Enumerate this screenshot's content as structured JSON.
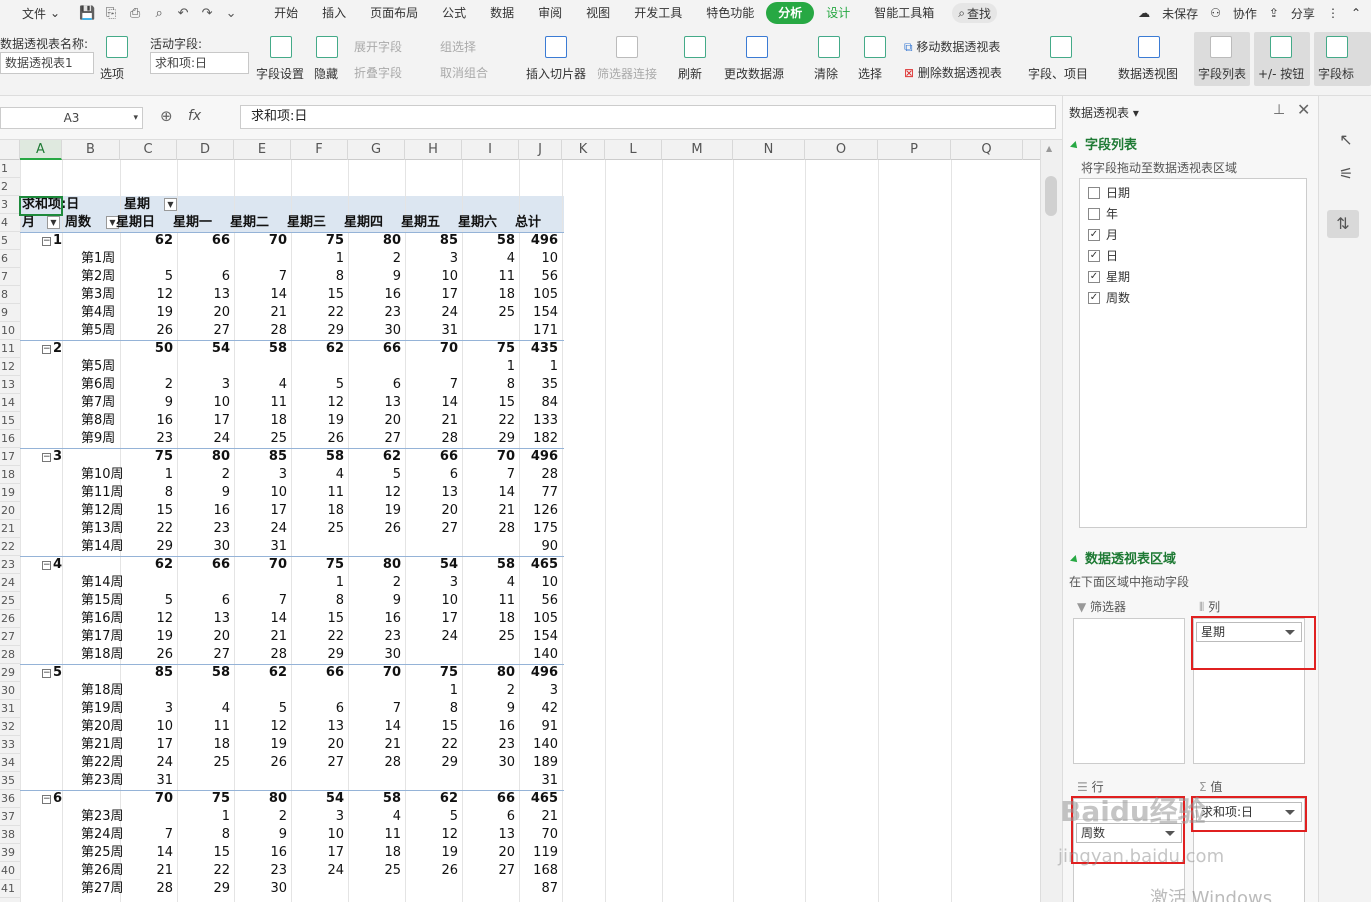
{
  "menu": {
    "file": "文件",
    "tabs": [
      "开始",
      "插入",
      "页面布局",
      "公式",
      "数据",
      "审阅",
      "视图",
      "开发工具",
      "特色功能",
      "分析",
      "设计",
      "智能工具箱"
    ],
    "active_tab": "分析",
    "search": "查找",
    "right": [
      "未保存",
      "协作",
      "分享"
    ]
  },
  "ribbon": {
    "pt_name_label": "数据透视表名称:",
    "pt_name_value": "数据透视表1",
    "options": "选项",
    "active_field_label": "活动字段:",
    "active_field_value": "求和项:日",
    "field_settings": "字段设置",
    "hide": "隐藏",
    "expand_field": "展开字段",
    "collapse_field": "折叠字段",
    "group_sel": "组选择",
    "ungroup": "取消组合",
    "insert_slicer": "插入切片器",
    "filter_conn": "筛选器连接",
    "refresh": "刷新",
    "change_source": "更改数据源",
    "clear": "清除",
    "select": "选择",
    "move_pt": "移动数据透视表",
    "delete_pt": "删除数据透视表",
    "fields_items": "字段、项目",
    "pivot_chart": "数据透视图",
    "field_list": "字段列表",
    "plus_minus": "+/- 按钮",
    "field_hdr": "字段标"
  },
  "formula": {
    "namebox": "A3",
    "fx": "fx",
    "value": "求和项:日"
  },
  "columns": [
    "A",
    "B",
    "C",
    "D",
    "E",
    "F",
    "G",
    "H",
    "I",
    "J",
    "K",
    "L",
    "M",
    "N",
    "O",
    "P",
    "Q"
  ],
  "pivot": {
    "title": "求和项:日",
    "col_field": "星期",
    "row_field1": "月",
    "row_field2": "周数",
    "headers": [
      "星期日",
      "星期一",
      "星期二",
      "星期三",
      "星期四",
      "星期五",
      "星期六",
      "总计"
    ],
    "rows": [
      {
        "t": "m",
        "label": "1",
        "v": [
          "62",
          "66",
          "70",
          "75",
          "80",
          "85",
          "58",
          "496"
        ]
      },
      {
        "t": "w",
        "label": "第1周",
        "v": [
          "",
          "",
          "",
          "1",
          "2",
          "3",
          "4",
          "10"
        ]
      },
      {
        "t": "w",
        "label": "第2周",
        "v": [
          "5",
          "6",
          "7",
          "8",
          "9",
          "10",
          "11",
          "56"
        ]
      },
      {
        "t": "w",
        "label": "第3周",
        "v": [
          "12",
          "13",
          "14",
          "15",
          "16",
          "17",
          "18",
          "105"
        ]
      },
      {
        "t": "w",
        "label": "第4周",
        "v": [
          "19",
          "20",
          "21",
          "22",
          "23",
          "24",
          "25",
          "154"
        ]
      },
      {
        "t": "w",
        "label": "第5周",
        "v": [
          "26",
          "27",
          "28",
          "29",
          "30",
          "31",
          "",
          "171"
        ]
      },
      {
        "t": "m",
        "label": "2",
        "v": [
          "50",
          "54",
          "58",
          "62",
          "66",
          "70",
          "75",
          "435"
        ]
      },
      {
        "t": "w",
        "label": "第5周",
        "v": [
          "",
          "",
          "",
          "",
          "",
          "",
          "1",
          "1"
        ]
      },
      {
        "t": "w",
        "label": "第6周",
        "v": [
          "2",
          "3",
          "4",
          "5",
          "6",
          "7",
          "8",
          "35"
        ]
      },
      {
        "t": "w",
        "label": "第7周",
        "v": [
          "9",
          "10",
          "11",
          "12",
          "13",
          "14",
          "15",
          "84"
        ]
      },
      {
        "t": "w",
        "label": "第8周",
        "v": [
          "16",
          "17",
          "18",
          "19",
          "20",
          "21",
          "22",
          "133"
        ]
      },
      {
        "t": "w",
        "label": "第9周",
        "v": [
          "23",
          "24",
          "25",
          "26",
          "27",
          "28",
          "29",
          "182"
        ]
      },
      {
        "t": "m",
        "label": "3",
        "v": [
          "75",
          "80",
          "85",
          "58",
          "62",
          "66",
          "70",
          "496"
        ]
      },
      {
        "t": "w",
        "label": "第10周",
        "v": [
          "1",
          "2",
          "3",
          "4",
          "5",
          "6",
          "7",
          "28"
        ]
      },
      {
        "t": "w",
        "label": "第11周",
        "v": [
          "8",
          "9",
          "10",
          "11",
          "12",
          "13",
          "14",
          "77"
        ]
      },
      {
        "t": "w",
        "label": "第12周",
        "v": [
          "15",
          "16",
          "17",
          "18",
          "19",
          "20",
          "21",
          "126"
        ]
      },
      {
        "t": "w",
        "label": "第13周",
        "v": [
          "22",
          "23",
          "24",
          "25",
          "26",
          "27",
          "28",
          "175"
        ]
      },
      {
        "t": "w",
        "label": "第14周",
        "v": [
          "29",
          "30",
          "31",
          "",
          "",
          "",
          "",
          "90"
        ]
      },
      {
        "t": "m",
        "label": "4",
        "v": [
          "62",
          "66",
          "70",
          "75",
          "80",
          "54",
          "58",
          "465"
        ]
      },
      {
        "t": "w",
        "label": "第14周",
        "v": [
          "",
          "",
          "",
          "1",
          "2",
          "3",
          "4",
          "10"
        ]
      },
      {
        "t": "w",
        "label": "第15周",
        "v": [
          "5",
          "6",
          "7",
          "8",
          "9",
          "10",
          "11",
          "56"
        ]
      },
      {
        "t": "w",
        "label": "第16周",
        "v": [
          "12",
          "13",
          "14",
          "15",
          "16",
          "17",
          "18",
          "105"
        ]
      },
      {
        "t": "w",
        "label": "第17周",
        "v": [
          "19",
          "20",
          "21",
          "22",
          "23",
          "24",
          "25",
          "154"
        ]
      },
      {
        "t": "w",
        "label": "第18周",
        "v": [
          "26",
          "27",
          "28",
          "29",
          "30",
          "",
          "",
          "140"
        ]
      },
      {
        "t": "m",
        "label": "5",
        "v": [
          "85",
          "58",
          "62",
          "66",
          "70",
          "75",
          "80",
          "496"
        ]
      },
      {
        "t": "w",
        "label": "第18周",
        "v": [
          "",
          "",
          "",
          "",
          "",
          "1",
          "2",
          "3"
        ]
      },
      {
        "t": "w",
        "label": "第19周",
        "v": [
          "3",
          "4",
          "5",
          "6",
          "7",
          "8",
          "9",
          "42"
        ]
      },
      {
        "t": "w",
        "label": "第20周",
        "v": [
          "10",
          "11",
          "12",
          "13",
          "14",
          "15",
          "16",
          "91"
        ]
      },
      {
        "t": "w",
        "label": "第21周",
        "v": [
          "17",
          "18",
          "19",
          "20",
          "21",
          "22",
          "23",
          "140"
        ]
      },
      {
        "t": "w",
        "label": "第22周",
        "v": [
          "24",
          "25",
          "26",
          "27",
          "28",
          "29",
          "30",
          "189"
        ]
      },
      {
        "t": "w",
        "label": "第23周",
        "v": [
          "31",
          "",
          "",
          "",
          "",
          "",
          "",
          "31"
        ]
      },
      {
        "t": "m",
        "label": "6",
        "v": [
          "70",
          "75",
          "80",
          "54",
          "58",
          "62",
          "66",
          "465"
        ]
      },
      {
        "t": "w",
        "label": "第23周",
        "v": [
          "",
          "1",
          "2",
          "3",
          "4",
          "5",
          "6",
          "21"
        ]
      },
      {
        "t": "w",
        "label": "第24周",
        "v": [
          "7",
          "8",
          "9",
          "10",
          "11",
          "12",
          "13",
          "70"
        ]
      },
      {
        "t": "w",
        "label": "第25周",
        "v": [
          "14",
          "15",
          "16",
          "17",
          "18",
          "19",
          "20",
          "119"
        ]
      },
      {
        "t": "w",
        "label": "第26周",
        "v": [
          "21",
          "22",
          "23",
          "24",
          "25",
          "26",
          "27",
          "168"
        ]
      },
      {
        "t": "w",
        "label": "第27周",
        "v": [
          "28",
          "29",
          "30",
          "",
          "",
          "",
          "",
          "87"
        ]
      }
    ]
  },
  "pane": {
    "title": "数据透视表",
    "field_list_title": "字段列表",
    "field_list_hint": "将字段拖动至数据透视表区域",
    "fields": [
      {
        "name": "日期",
        "checked": false
      },
      {
        "name": "年",
        "checked": false
      },
      {
        "name": "月",
        "checked": true
      },
      {
        "name": "日",
        "checked": true
      },
      {
        "name": "星期",
        "checked": true
      },
      {
        "name": "周数",
        "checked": true
      }
    ],
    "areas_title": "数据透视表区域",
    "areas_hint": "在下面区域中拖动字段",
    "filter_label": "筛选器",
    "column_label": "列",
    "column_item": "星期",
    "row_label": "行",
    "row_item": "周数",
    "value_label": "值",
    "value_item": "求和项:日"
  },
  "watermark": {
    "brand": "Baidu经验",
    "url": "jingyan.baidu.com",
    "activate": "激活 Windows"
  }
}
